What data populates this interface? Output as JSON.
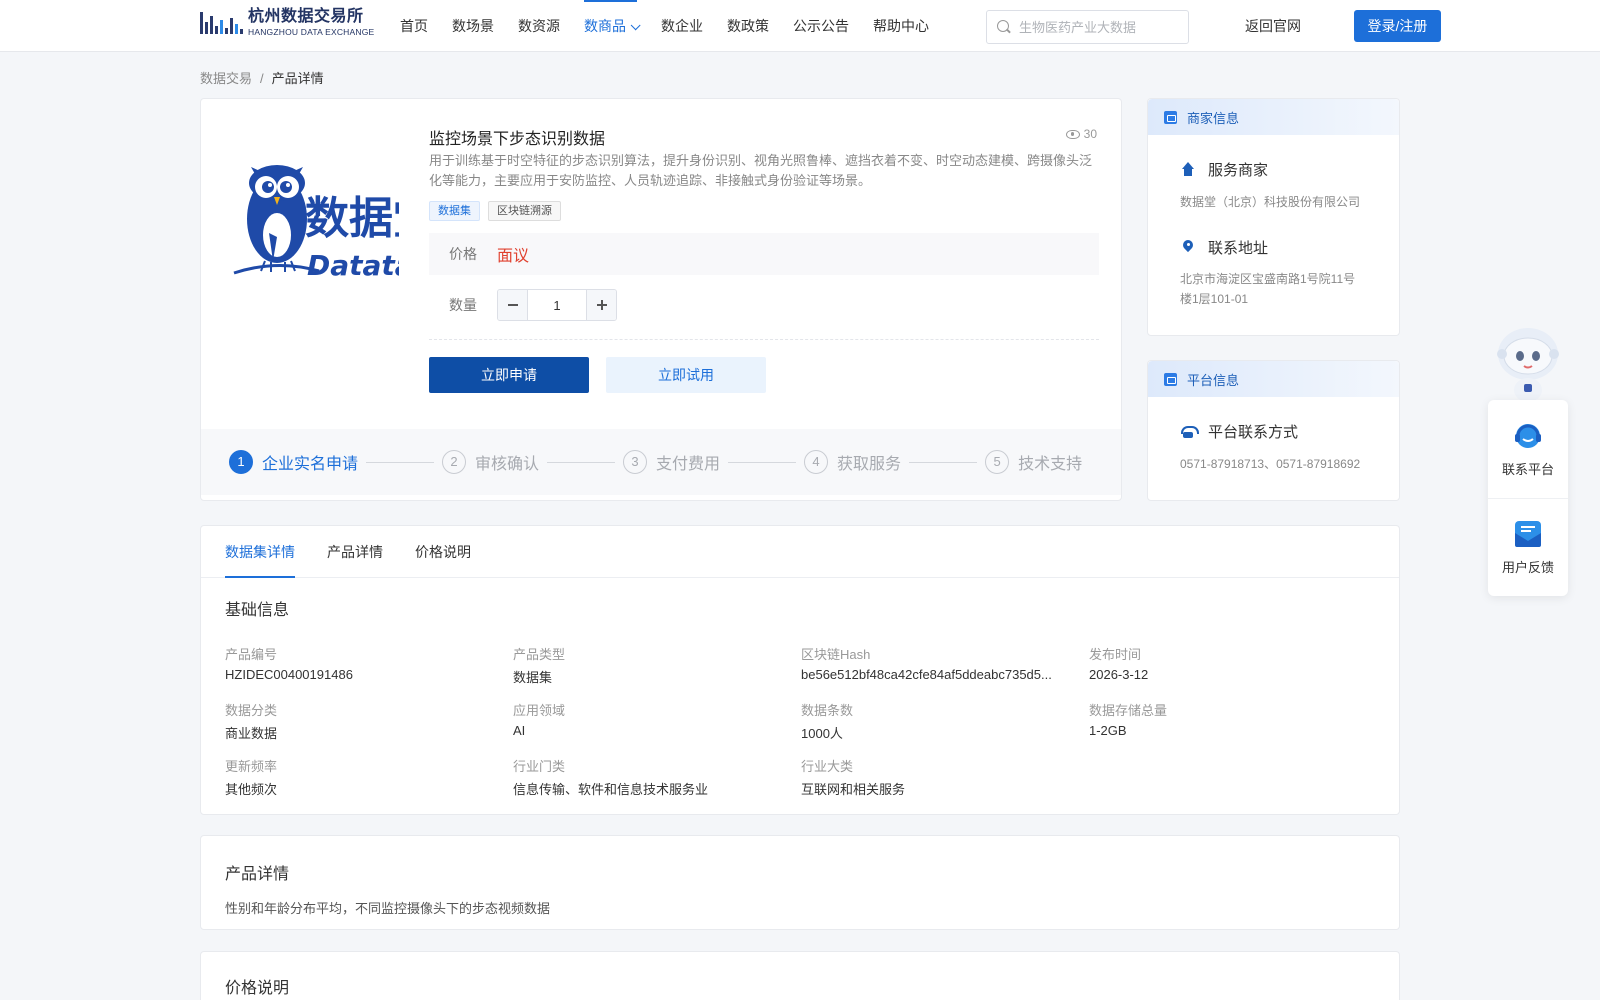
{
  "header": {
    "logo_cn": "杭州数据交易所",
    "logo_en": "HANGZHOU DATA EXCHANGE",
    "nav": [
      {
        "label": "首页"
      },
      {
        "label": "数场景"
      },
      {
        "label": "数资源"
      },
      {
        "label": "数商品"
      },
      {
        "label": "数企业"
      },
      {
        "label": "数政策"
      },
      {
        "label": "公示公告"
      },
      {
        "label": "帮助中心"
      }
    ],
    "active_nav": "数商品",
    "search_placeholder": "生物医药产业大数据",
    "back_link": "返回官网",
    "login_label": "登录/注册"
  },
  "breadcrumb": {
    "root": "数据交易",
    "separator": "/",
    "current": "产品详情"
  },
  "product": {
    "title": "监控场景下步态识别数据",
    "views": "30",
    "description": "用于训练基于时空特征的步态识别算法，提升身份识别、视角光照鲁棒、遮挡衣着不变、时空动态建模、跨摄像头泛化等能力，主要应用于安防监控、人员轨迹追踪、非接触式身份验证等场景。",
    "tags": [
      "数据集",
      "区块链溯源"
    ],
    "price_label": "价格",
    "price_value": "面议",
    "qty_label": "数量",
    "qty_value": "1",
    "apply_label": "立即申请",
    "trial_label": "立即试用",
    "logo_text": "数据堂",
    "logo_en": "Datatang"
  },
  "steps": [
    {
      "num": "1",
      "label": "企业实名申请",
      "active": true
    },
    {
      "num": "2",
      "label": "审核确认",
      "active": false
    },
    {
      "num": "3",
      "label": "支付费用",
      "active": false
    },
    {
      "num": "4",
      "label": "获取服务",
      "active": false
    },
    {
      "num": "5",
      "label": "技术支持",
      "active": false
    }
  ],
  "merchant": {
    "header": "商家信息",
    "service_title": "服务商家",
    "service_value": "数据堂（北京）科技股份有限公司",
    "address_title": "联系地址",
    "address_value": "北京市海淀区宝盛南路1号院11号楼1层101-01"
  },
  "platform": {
    "header": "平台信息",
    "contact_title": "平台联系方式",
    "contact_value": "0571-87918713、0571-87918692"
  },
  "floating": {
    "contact_label": "联系平台",
    "feedback_label": "用户反馈"
  },
  "details": {
    "tabs": [
      "数据集详情",
      "产品详情",
      "价格说明"
    ],
    "active_tab": "数据集详情",
    "basic_title": "基础信息",
    "fields": [
      {
        "label": "产品编号",
        "value": "HZIDEC00400191486"
      },
      {
        "label": "产品类型",
        "value": "数据集"
      },
      {
        "label": "区块链Hash",
        "value": "be56e512bf48ca42cfe84af5ddeabc735d5..."
      },
      {
        "label": "发布时间",
        "value": "2026-3-12"
      },
      {
        "label": "数据分类",
        "value": "商业数据"
      },
      {
        "label": "应用领域",
        "value": "AI"
      },
      {
        "label": "数据条数",
        "value": "1000人"
      },
      {
        "label": "数据存储总量",
        "value": "1-2GB"
      },
      {
        "label": "更新频率",
        "value": "其他频次"
      },
      {
        "label": "行业门类",
        "value": "信息传输、软件和信息技术服务业"
      },
      {
        "label": "行业大类",
        "value": "互联网和相关服务"
      }
    ],
    "product_detail_title": "产品详情",
    "product_detail_text": "性别和年龄分布平均，不同监控摄像头下的步态视频数据",
    "price_title": "价格说明"
  },
  "colors": {
    "primary": "#1d6fd9",
    "primary_dark": "#0e4ea6",
    "price_red": "#e0412f"
  }
}
